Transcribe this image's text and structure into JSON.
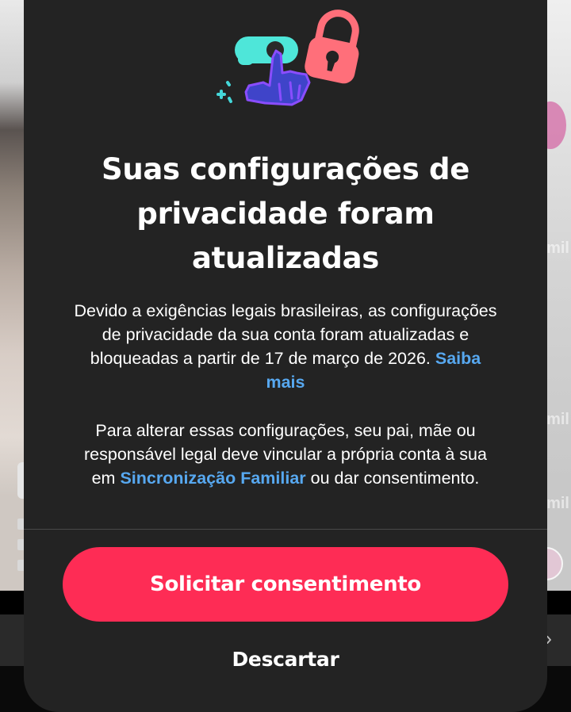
{
  "modal": {
    "title": "Suas configurações de privacidade foram atualizadas",
    "paragraph1": {
      "text": "Devido a exigências legais brasileiras, as configurações de privacidade da sua conta foram atualizadas e bloqueadas a partir de 17 de março de 2026.",
      "link_label": "Saiba mais"
    },
    "paragraph2": {
      "text_before": "Para alterar essas configurações, seu pai, mãe ou responsável legal deve vincular a própria conta à sua em",
      "link_label": "Sincronização Familiar",
      "text_after": "ou dar consentimento."
    },
    "primary_button_label": "Solicitar consentimento",
    "dismiss_button_label": "Descartar",
    "hero_icons": [
      "hand-pointer-icon",
      "padlock-icon",
      "sparkle-icon"
    ]
  },
  "colors": {
    "sheet_background": "#232323",
    "primary_button": "#fe2c55",
    "link": "#57a8f0",
    "text": "#ffffff",
    "divider": "#4a4a4a"
  }
}
